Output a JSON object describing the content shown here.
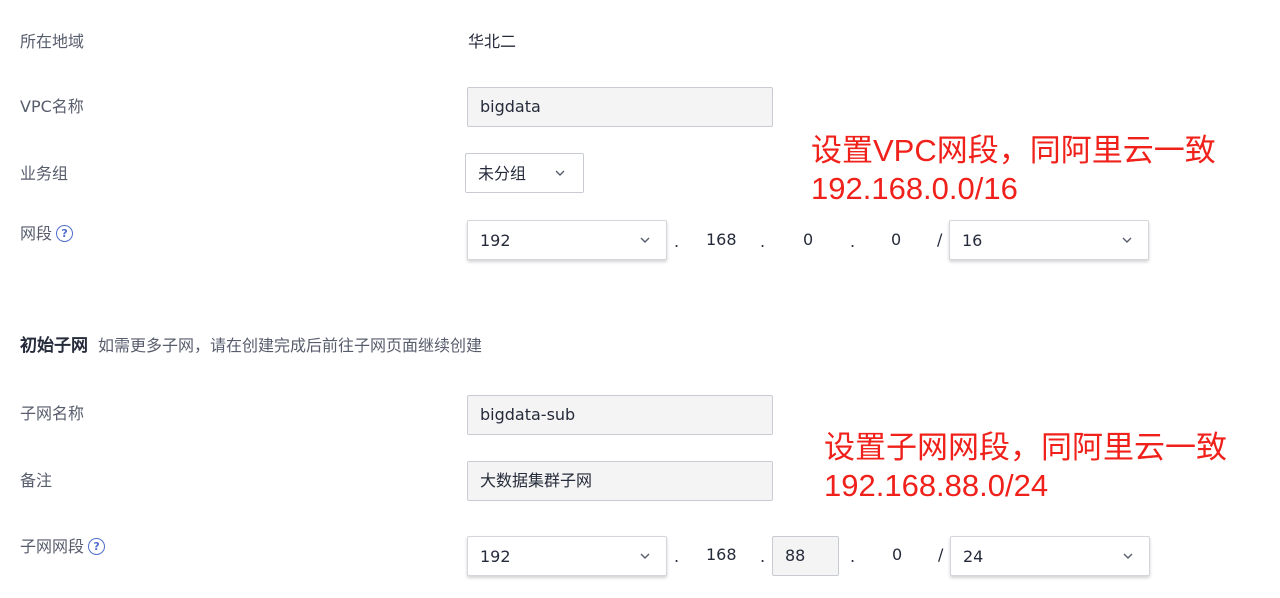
{
  "region": {
    "label": "所在地域",
    "value": "华北二"
  },
  "vpc_name": {
    "label": "VPC名称",
    "value": "bigdata"
  },
  "business_group": {
    "label": "业务组",
    "value": "未分组"
  },
  "cidr": {
    "label": "网段",
    "octet1": "192",
    "octet2": "168",
    "octet3": "0",
    "octet4": "0",
    "separator": ".",
    "slash": "/",
    "mask": "16"
  },
  "annotation1": {
    "line1": "设置VPC网段，同阿里云一致",
    "line2": "192.168.0.0/16"
  },
  "initial_subnet": {
    "title": "初始子网",
    "description": "如需更多子网，请在创建完成后前往子网页面继续创建"
  },
  "subnet_name": {
    "label": "子网名称",
    "value": "bigdata-sub"
  },
  "remark": {
    "label": "备注",
    "value": "大数据集群子网"
  },
  "subnet_cidr": {
    "label": "子网网段",
    "octet1": "192",
    "octet2": "168",
    "octet3": "88",
    "octet4": "0",
    "separator": ".",
    "slash": "/",
    "mask": "24"
  },
  "annotation2": {
    "line1": "设置子网网段，同阿里云一致",
    "line2": "192.168.88.0/24"
  },
  "icons": {
    "help": "question-circle-icon",
    "dropdown": "chevron-down-icon"
  },
  "colors": {
    "annotation": "#f0201a",
    "help_icon": "#526ecc"
  }
}
